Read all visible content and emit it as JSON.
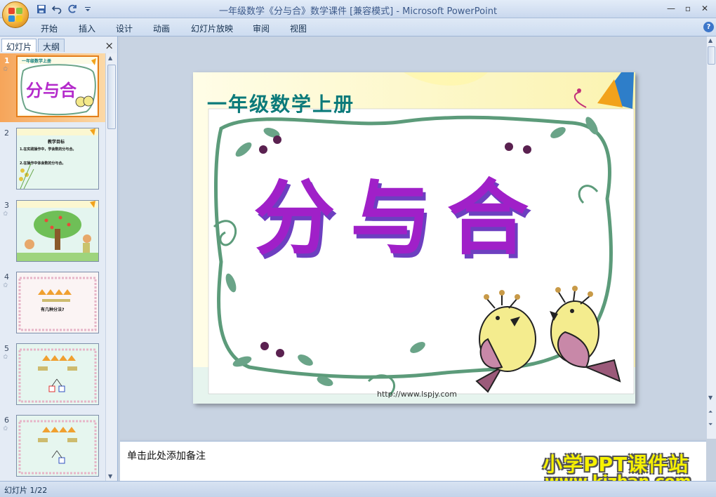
{
  "window": {
    "title": "一年级数学《分与合》数学课件 [兼容模式] - Microsoft PowerPoint"
  },
  "quick_access": [
    "save-icon",
    "undo-icon",
    "redo-icon",
    "customize-icon"
  ],
  "ribbon": {
    "tabs": [
      "开始",
      "插入",
      "设计",
      "动画",
      "幻灯片放映",
      "审阅",
      "视图"
    ]
  },
  "panel": {
    "tabs": [
      "幻灯片",
      "大纲"
    ],
    "close": "×"
  },
  "thumbnails": [
    {
      "num": "1",
      "title": "分与合",
      "header": "一年级数学上册"
    },
    {
      "num": "2",
      "title": "教学目标",
      "lines": [
        "1.在实践操作中，学会数的分与合。",
        "2.在操作中体会数的分与合。"
      ]
    },
    {
      "num": "3"
    },
    {
      "num": "4",
      "line": "有几种分法?"
    },
    {
      "num": "5"
    },
    {
      "num": "6"
    }
  ],
  "slide": {
    "header": "一年级数学上册",
    "title": "分与合",
    "footer": "http://www.lspjy.com"
  },
  "notes": {
    "placeholder": "单击此处添加备注"
  },
  "watermark": {
    "line1": "小学PPT课件站",
    "line2": "www.kjzhan.com"
  },
  "status": {
    "slide_indicator": "幻灯片 1/22"
  },
  "colors": {
    "accent_orange": "#f6a55a",
    "title_purple": "#a020c8",
    "header_teal": "#0b7a7a",
    "vine_green": "#5c9b7a"
  }
}
